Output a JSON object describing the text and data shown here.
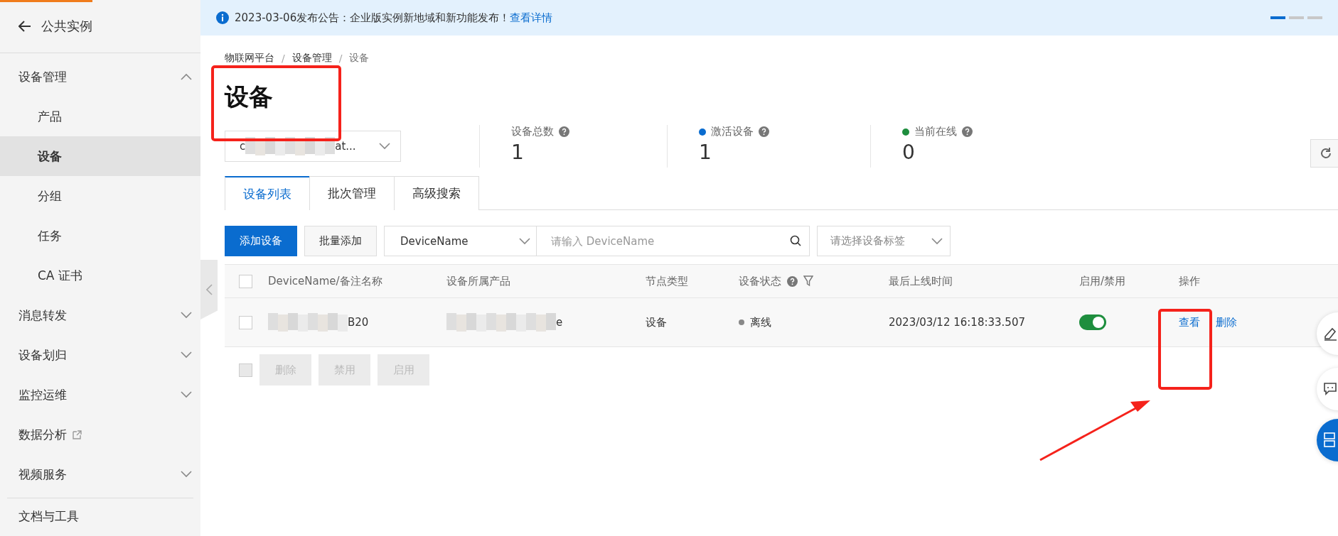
{
  "sidebar": {
    "back": {
      "label": "公共实例"
    },
    "items": [
      {
        "label": "设备管理",
        "kind": "group",
        "expanded": true,
        "children": [
          {
            "label": "产品",
            "selected": false
          },
          {
            "label": "设备",
            "selected": true
          },
          {
            "label": "分组",
            "selected": false
          },
          {
            "label": "任务",
            "selected": false
          },
          {
            "label": "CA 证书",
            "selected": false
          }
        ]
      },
      {
        "label": "消息转发",
        "kind": "group",
        "expanded": false
      },
      {
        "label": "设备划归",
        "kind": "group",
        "expanded": false
      },
      {
        "label": "监控运维",
        "kind": "group",
        "expanded": false
      },
      {
        "label": "数据分析",
        "kind": "external"
      },
      {
        "label": "视频服务",
        "kind": "group",
        "expanded": false
      }
    ],
    "footer": [
      {
        "label": "文档与工具"
      }
    ]
  },
  "banner": {
    "text": "2023-03-06发布公告：企业版实例新地域和新功能发布！",
    "link": "查看详情",
    "pager": [
      {
        "selected": true
      },
      {
        "selected": false
      },
      {
        "selected": false
      }
    ]
  },
  "breadcrumb": [
    {
      "label": "物联网平台"
    },
    {
      "separator": "/",
      "label": "设备管理"
    },
    {
      "separator": "/",
      "label": "设备"
    }
  ],
  "title": "设备",
  "product_select": {
    "value_start": "c",
    "value_end": "at..."
  },
  "stats": [
    {
      "label": "设备总数",
      "value": "1"
    },
    {
      "label": "激活设备",
      "value": "1",
      "color": "#0a6ccf"
    },
    {
      "label": "当前在线",
      "value": "0",
      "color": "#1e8e3e"
    }
  ],
  "tabs": [
    {
      "label": "设备列表",
      "selected": true
    },
    {
      "label": "批次管理",
      "selected": false
    },
    {
      "label": "高级搜索",
      "selected": false
    }
  ],
  "toolbar": {
    "add": "添加设备",
    "batch_add": "批量添加",
    "field_select": "DeviceName",
    "search_placeholder": "请输入 DeviceName",
    "tag_placeholder": "请选择设备标签"
  },
  "table": {
    "header_checked": false,
    "columns": [
      "DeviceName/备注名称",
      "设备所属产品",
      "节点类型",
      "设备状态",
      "最后上线时间",
      "启用/禁用",
      "操作"
    ],
    "rows": [
      {
        "checked": false,
        "device_name": "B20",
        "product": "e",
        "node_type": "设备",
        "status": "离线",
        "online": false,
        "last_online": "2023/03/12 16:18:33.507",
        "enabled": true,
        "actions": [
          "查看",
          "删除"
        ]
      }
    ]
  },
  "batch_select": {
    "checked": false,
    "disabled": true
  },
  "batch_actions": [
    {
      "label": "删除",
      "disabled": true
    },
    {
      "label": "禁用",
      "disabled": true
    },
    {
      "label": "启用",
      "disabled": true
    }
  ],
  "annotations": [
    {
      "kind": "box"
    },
    {
      "kind": "box"
    },
    {
      "kind": "arrow"
    }
  ]
}
